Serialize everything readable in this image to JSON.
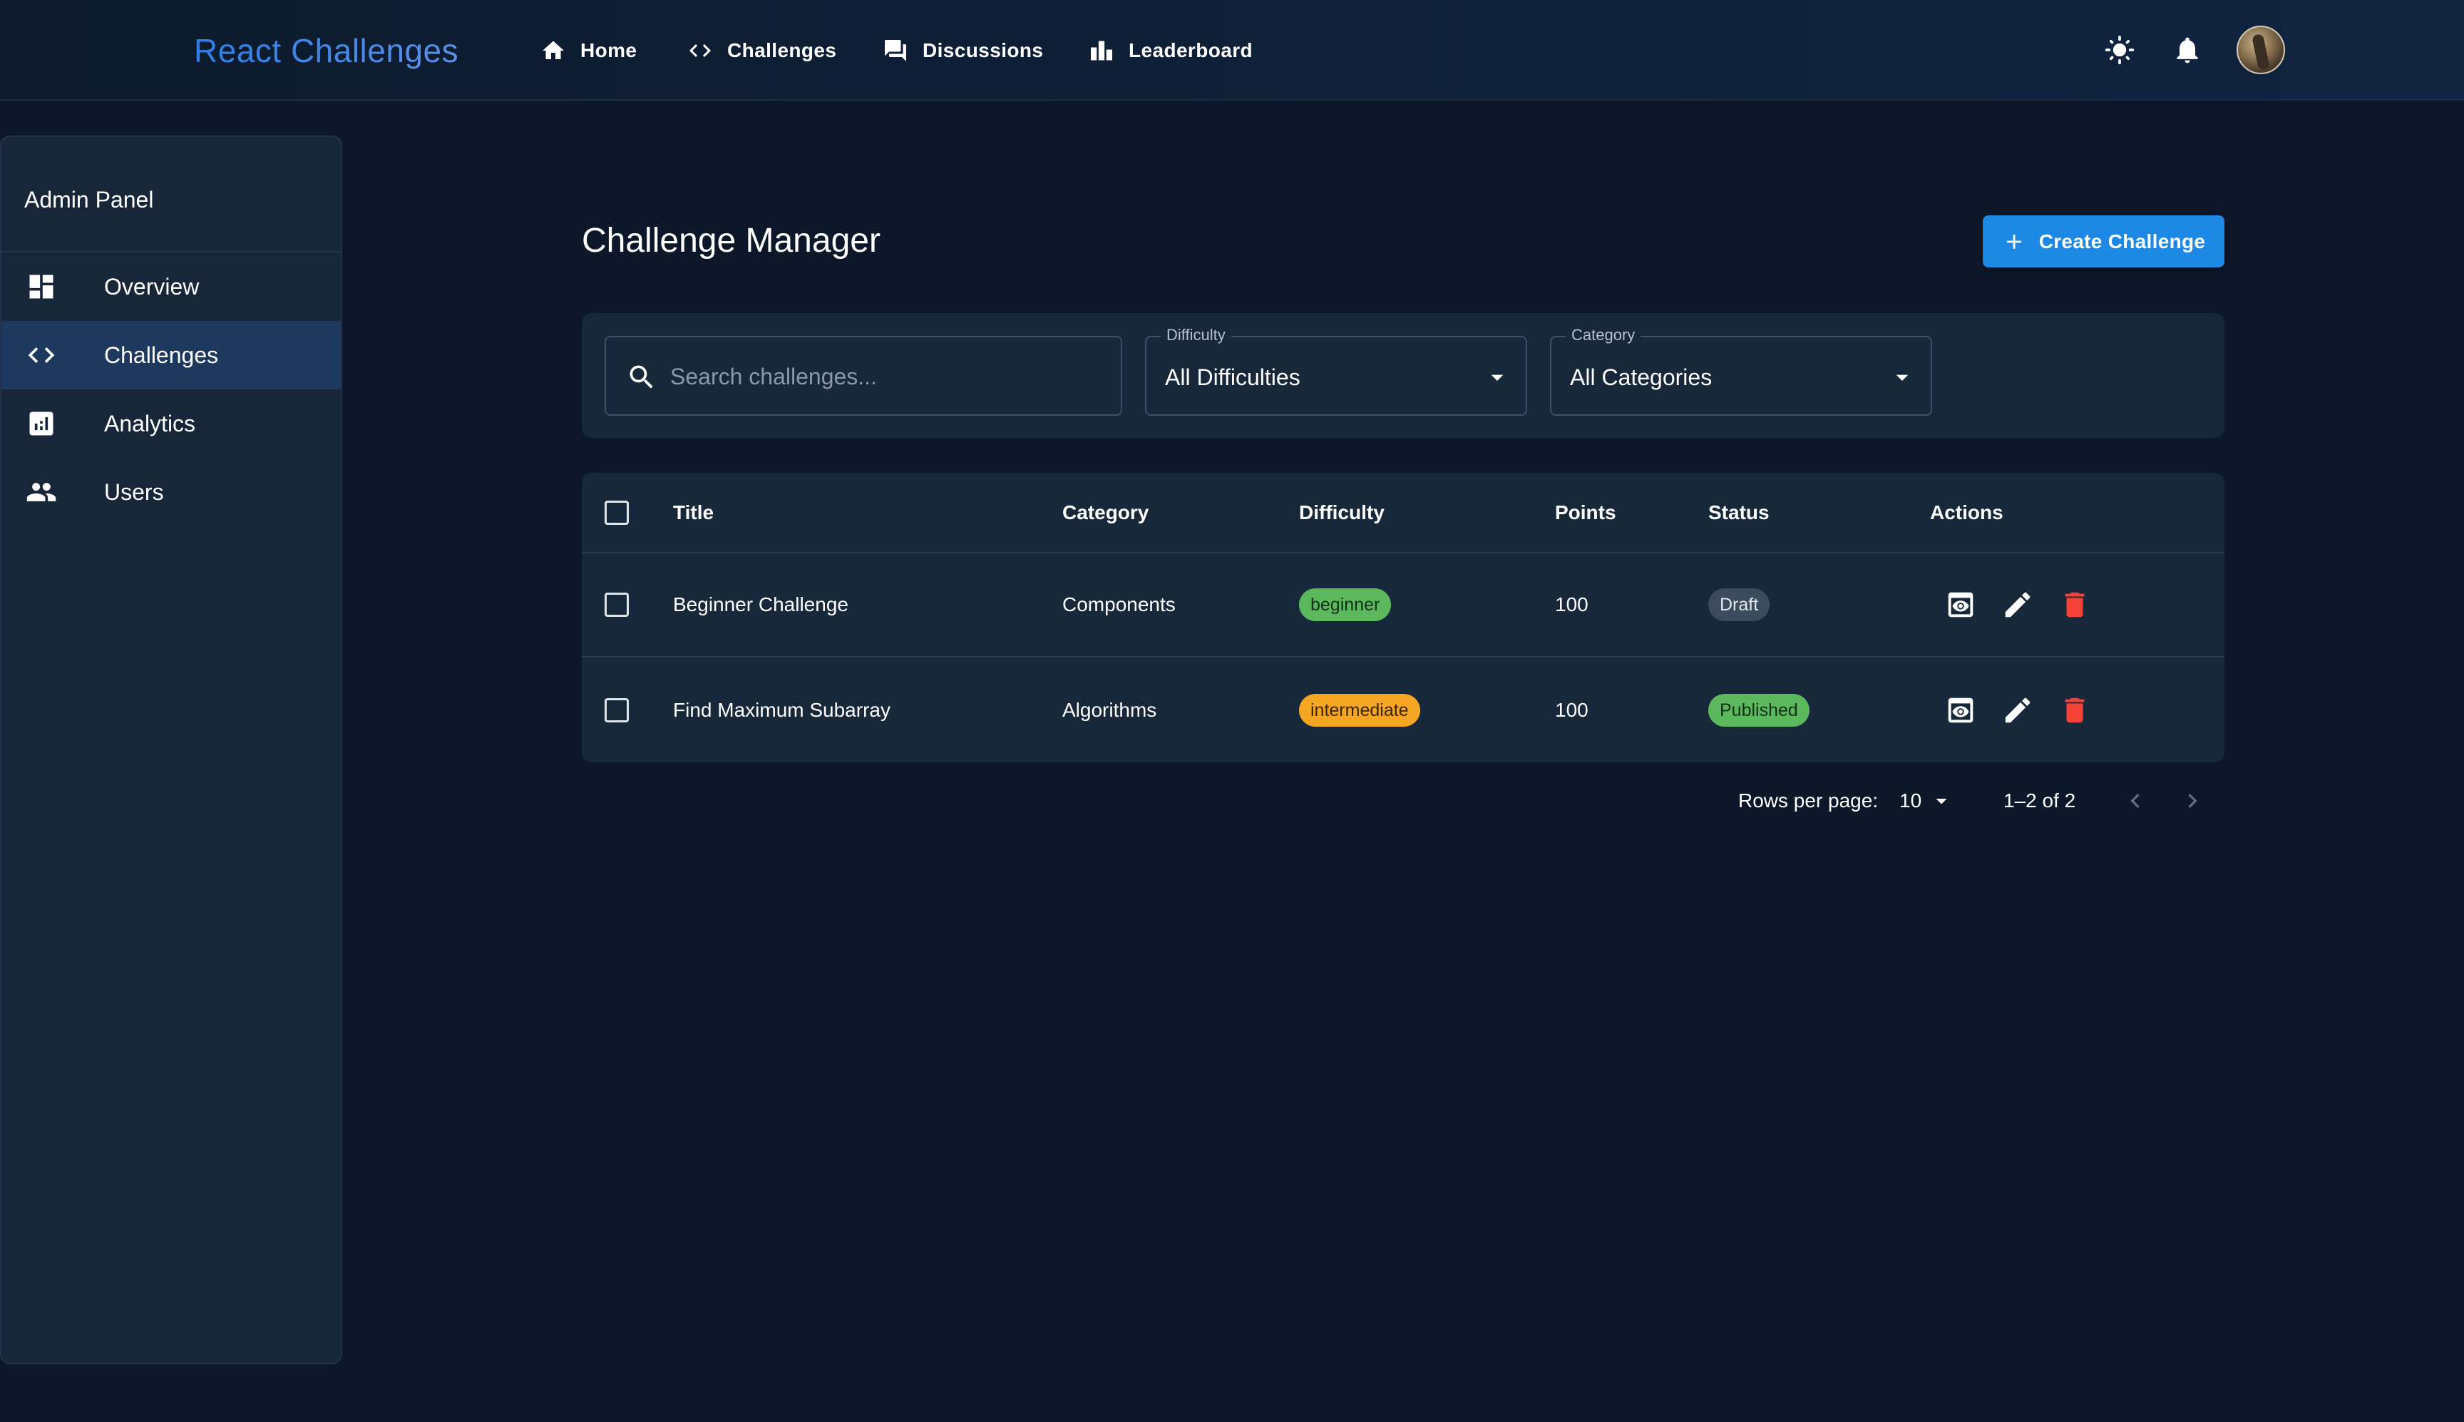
{
  "app": {
    "brand": "React Challenges"
  },
  "topnav": {
    "items": [
      {
        "label": "Home",
        "icon": "home-icon"
      },
      {
        "label": "Challenges",
        "icon": "code-icon"
      },
      {
        "label": "Discussions",
        "icon": "forum-icon"
      },
      {
        "label": "Leaderboard",
        "icon": "leaderboard-icon"
      }
    ],
    "actions": [
      "theme-toggle-icon",
      "notifications-icon",
      "avatar"
    ]
  },
  "sidebar": {
    "title": "Admin Panel",
    "items": [
      {
        "label": "Overview",
        "icon": "dashboard-icon",
        "active": false
      },
      {
        "label": "Challenges",
        "icon": "code-icon",
        "active": true
      },
      {
        "label": "Analytics",
        "icon": "analytics-icon",
        "active": false
      },
      {
        "label": "Users",
        "icon": "people-icon",
        "active": false
      }
    ]
  },
  "main": {
    "title": "Challenge Manager",
    "create_label": "Create Challenge",
    "search": {
      "placeholder": "Search challenges...",
      "value": ""
    },
    "filters": {
      "difficulty": {
        "label": "Difficulty",
        "value": "All Difficulties"
      },
      "category": {
        "label": "Category",
        "value": "All Categories"
      }
    },
    "table": {
      "columns": [
        "Title",
        "Category",
        "Difficulty",
        "Points",
        "Status",
        "Actions"
      ],
      "rows": [
        {
          "title": "Beginner Challenge",
          "category": "Components",
          "difficulty": "beginner",
          "points": "100",
          "status": "Draft"
        },
        {
          "title": "Find Maximum Subarray",
          "category": "Algorithms",
          "difficulty": "intermediate",
          "points": "100",
          "status": "Published"
        }
      ]
    },
    "pagination": {
      "rows_label": "Rows per page:",
      "rows_value": "10",
      "range": "1–2 of 2"
    }
  },
  "colors": {
    "background": "#0c1829",
    "surface": "#17283b",
    "accent": "#1e88e5",
    "brand": "#3b86e8",
    "success": "#5cb85c",
    "warning": "#f5a623",
    "danger": "#f44336"
  }
}
